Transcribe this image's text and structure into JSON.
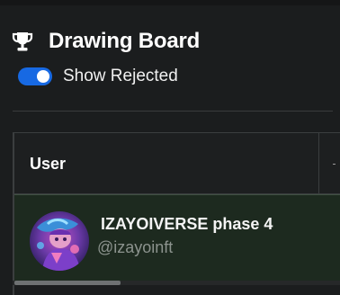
{
  "board": {
    "title": "Drawing Board",
    "icon": "trophy-icon"
  },
  "filters": {
    "show_rejected_label": "Show Rejected",
    "show_rejected_enabled": true,
    "toggle_color": "#1769e3"
  },
  "table": {
    "columns": [
      "User"
    ],
    "rows": [
      {
        "name": "IZAYOIVERSE phase 4",
        "handle": "@izayoinft",
        "avatar": "avatar-image"
      }
    ],
    "highlight_row_color": "#1d2a1f"
  }
}
